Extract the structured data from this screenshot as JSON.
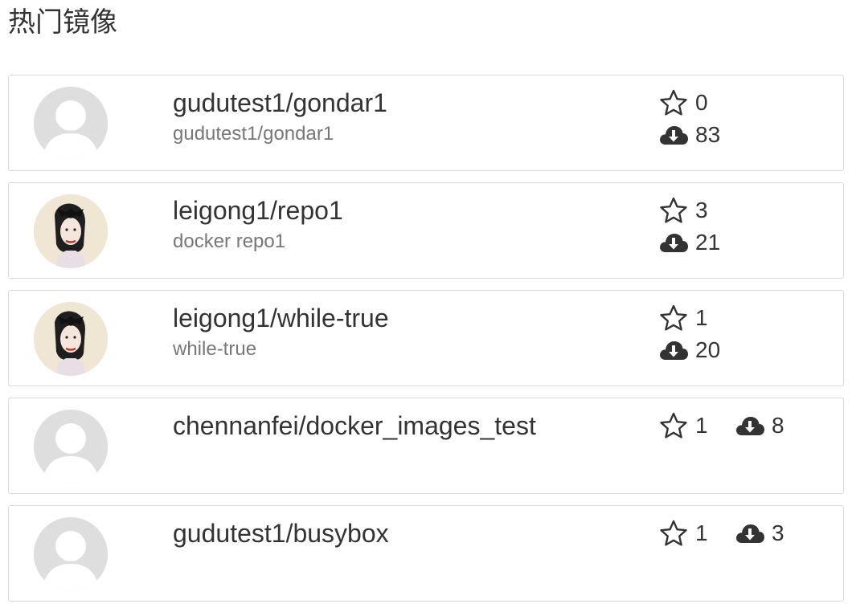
{
  "page": {
    "title": "热门镜像"
  },
  "repos": [
    {
      "name": "gudutest1/gondar1",
      "description": "gudutest1/gondar1",
      "stars": "0",
      "downloads": "83",
      "avatar": "default-user-avatar",
      "stats_layout": "stacked"
    },
    {
      "name": "leigong1/repo1",
      "description": "docker repo1",
      "stars": "3",
      "downloads": "21",
      "avatar": "user-photo-avatar",
      "stats_layout": "stacked"
    },
    {
      "name": "leigong1/while-true",
      "description": "while-true",
      "stars": "1",
      "downloads": "20",
      "avatar": "user-photo-avatar",
      "stats_layout": "stacked"
    },
    {
      "name": "chennanfei/docker_images_test",
      "description": "",
      "stars": "1",
      "downloads": "8",
      "avatar": "default-user-avatar",
      "stats_layout": "inline"
    },
    {
      "name": "gudutest1/busybox",
      "description": "",
      "stars": "1",
      "downloads": "3",
      "avatar": "default-user-avatar",
      "stats_layout": "inline"
    }
  ],
  "icons": {
    "star": "star-outline-icon",
    "download": "cloud-download-icon"
  },
  "colors": {
    "text": "#333333",
    "muted": "#777777",
    "border": "#d9d9d9",
    "avatar_default": "#dedede"
  }
}
